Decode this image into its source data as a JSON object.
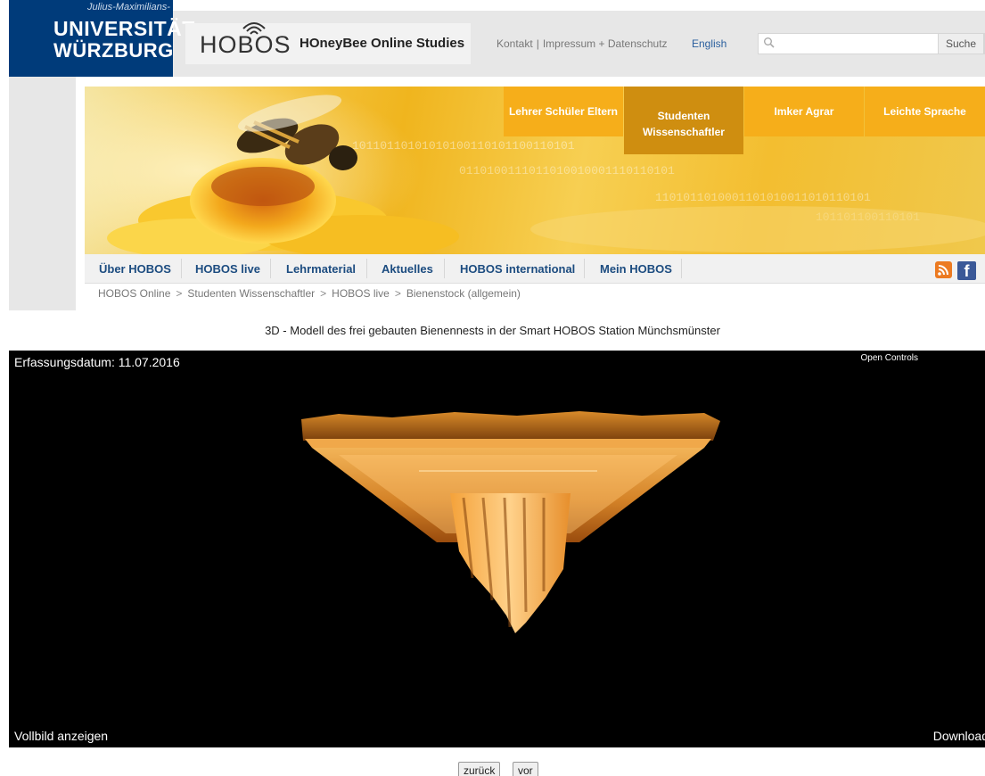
{
  "header": {
    "uni_top": "Julius-Maximilians-",
    "uni_line1": "UNIVERSITÄT",
    "uni_line2": "WÜRZBURG",
    "hobos_word": "HOBOS",
    "hobos_sub": "HOneyBee Online Studies",
    "links": [
      "Kontakt",
      "Impressum + Datenschutz"
    ],
    "lang": "English",
    "search": {
      "placeholder": "",
      "button": "Suche"
    }
  },
  "audience_nav": [
    "Lehrer Schüler Eltern",
    "Studenten Wissenschaftler",
    "Imker Agrar",
    "Leichte Sprache"
  ],
  "main_nav": [
    "Über HOBOS",
    "HOBOS live",
    "Lehrmaterial",
    "Aktuelles",
    "HOBOS international",
    "Mein HOBOS"
  ],
  "breadcrumb": [
    "HOBOS Online",
    "Studenten Wissenschaftler",
    "HOBOS live",
    "Bienenstock (allgemein)"
  ],
  "model": {
    "title": "3D - Modell des frei gebauten Bienennests in der Smart HOBOS Station Münchsmünster",
    "date_label": "Erfassungsdatum: 11.07.2016",
    "open_controls": "Open Controls",
    "fullscreen": "Vollbild anzeigen",
    "download": "Download"
  },
  "pager": {
    "back": "zurück",
    "forward": "vor"
  },
  "colors": {
    "uni_blue": "#003b7a",
    "nav_blue": "#1c4c80",
    "accent_orange": "#f6ae1a",
    "active_orange": "#cf8e10"
  }
}
